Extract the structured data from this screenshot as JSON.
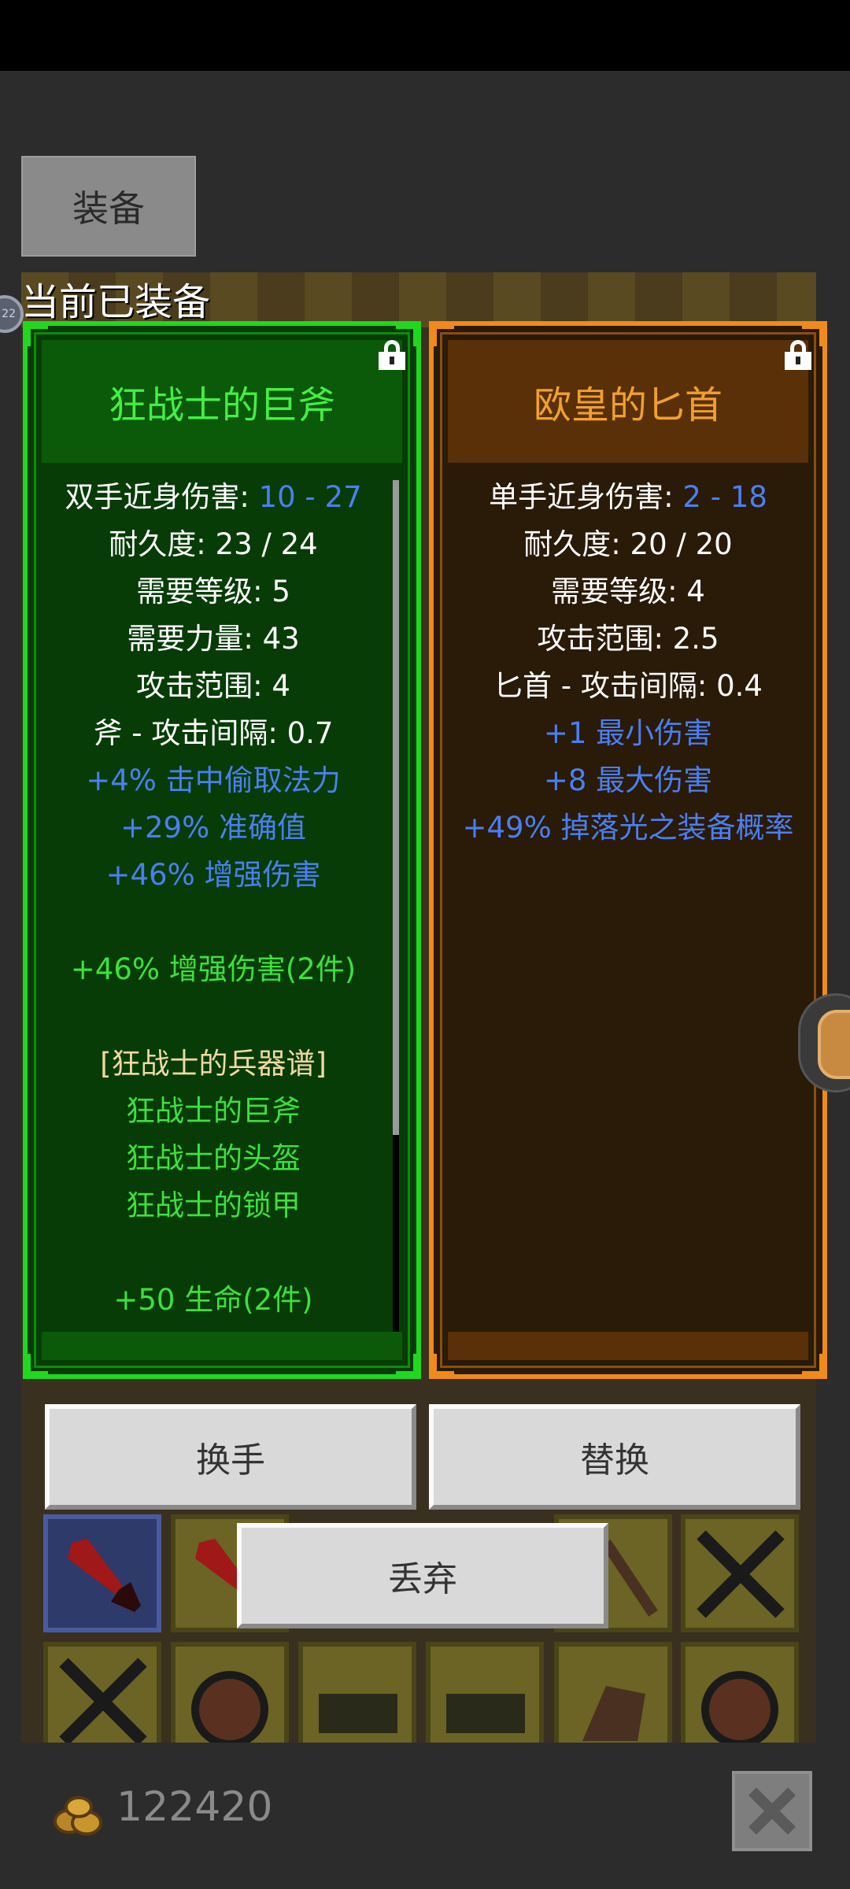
{
  "tabs": {
    "equip_label": "装备"
  },
  "current_equipped_label": "当前已装备",
  "left_badge_text": "22",
  "left_item": {
    "name": "狂战士的巨斧",
    "rarity_color": "#44ee44",
    "stats": [
      {
        "label": "双手近身伤害: ",
        "value": "10 - 27"
      },
      {
        "text": "耐久度: 23 / 24"
      },
      {
        "text": "需要等级: 5"
      },
      {
        "text": "需要力量: 43"
      },
      {
        "text": "攻击范围: 4"
      },
      {
        "text": "斧 - 攻击间隔: 0.7"
      }
    ],
    "affixes": [
      "+4% 击中偷取法力",
      "+29% 准确值",
      "+46% 增强伤害"
    ],
    "set_bonus_1": "+46% 增强伤害(2件)",
    "set_name": "[狂战士的兵器谱]",
    "set_items": [
      "狂战士的巨斧",
      "狂战士的头盔",
      "狂战士的锁甲"
    ],
    "set_bonus_2": "+50 生命(2件)"
  },
  "right_item": {
    "name": "欧皇的匕首",
    "rarity_color": "#f0a030",
    "stats": [
      {
        "label": "单手近身伤害: ",
        "value": "2 - 18"
      },
      {
        "text": "耐久度: 20 / 20"
      },
      {
        "text": "需要等级: 4"
      },
      {
        "text": "攻击范围: 2.5"
      },
      {
        "text": "匕首 - 攻击间隔: 0.4"
      }
    ],
    "affixes": [
      "+1 最小伤害",
      "+8 最大伤害",
      "+49% 掉落光之装备概率"
    ]
  },
  "actions": {
    "swap_hands": "换手",
    "replace": "替换",
    "discard": "丢弃"
  },
  "gold": "122420",
  "colors": {
    "stat_white": "#ffffff",
    "affix_blue": "#4a7ff0",
    "set_green": "#3ee03e",
    "set_title": "#f0d8a0",
    "left_frame": "#1fd81f",
    "right_frame": "#f08a1a"
  }
}
